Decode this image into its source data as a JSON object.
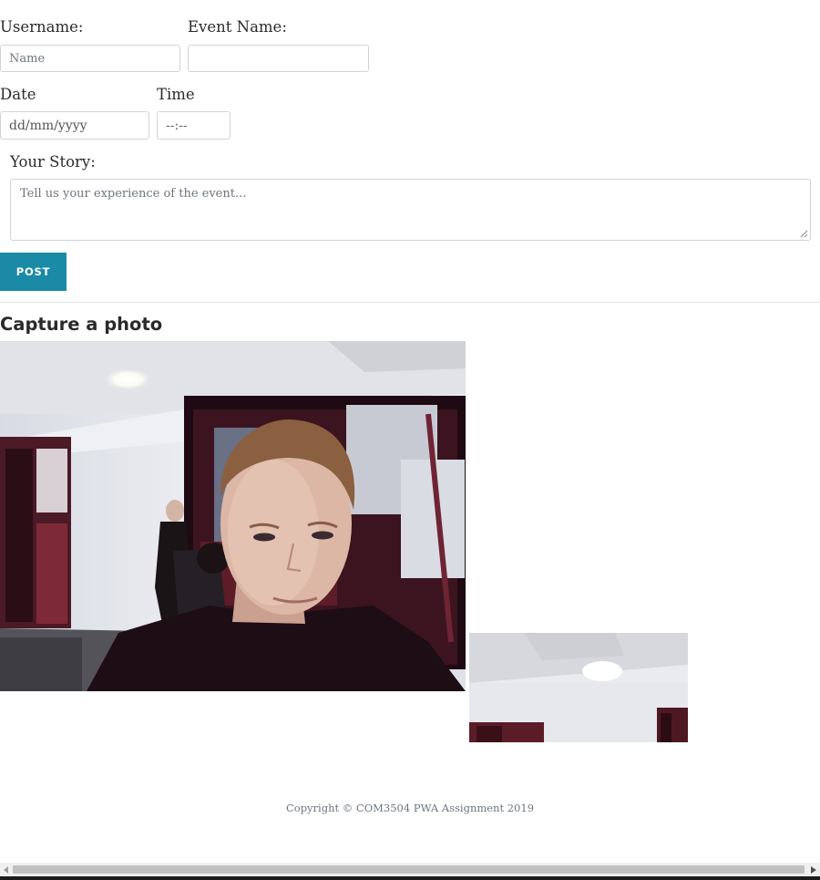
{
  "form": {
    "username": {
      "label": "Username:",
      "placeholder": "Name",
      "value": ""
    },
    "event_name": {
      "label": "Event Name:",
      "placeholder": "",
      "value": ""
    },
    "date": {
      "label": "Date",
      "placeholder": "dd/mm/yyyy"
    },
    "time": {
      "label": "Time",
      "placeholder": "--:--"
    },
    "story": {
      "label": "Your Story:",
      "placeholder": "Tell us your experience of the event..."
    },
    "post_label": "POST"
  },
  "capture": {
    "title": "Capture a photo",
    "video_icon": "webcam-live-feed",
    "snapshot_icon": "captured-photo-thumbnail"
  },
  "footer": {
    "text": "Copyright © COM3504 PWA Assignment 2019"
  },
  "colors": {
    "accent": "#1a8aa6",
    "border": "#cfd4d9",
    "muted_text": "#6c757d"
  }
}
